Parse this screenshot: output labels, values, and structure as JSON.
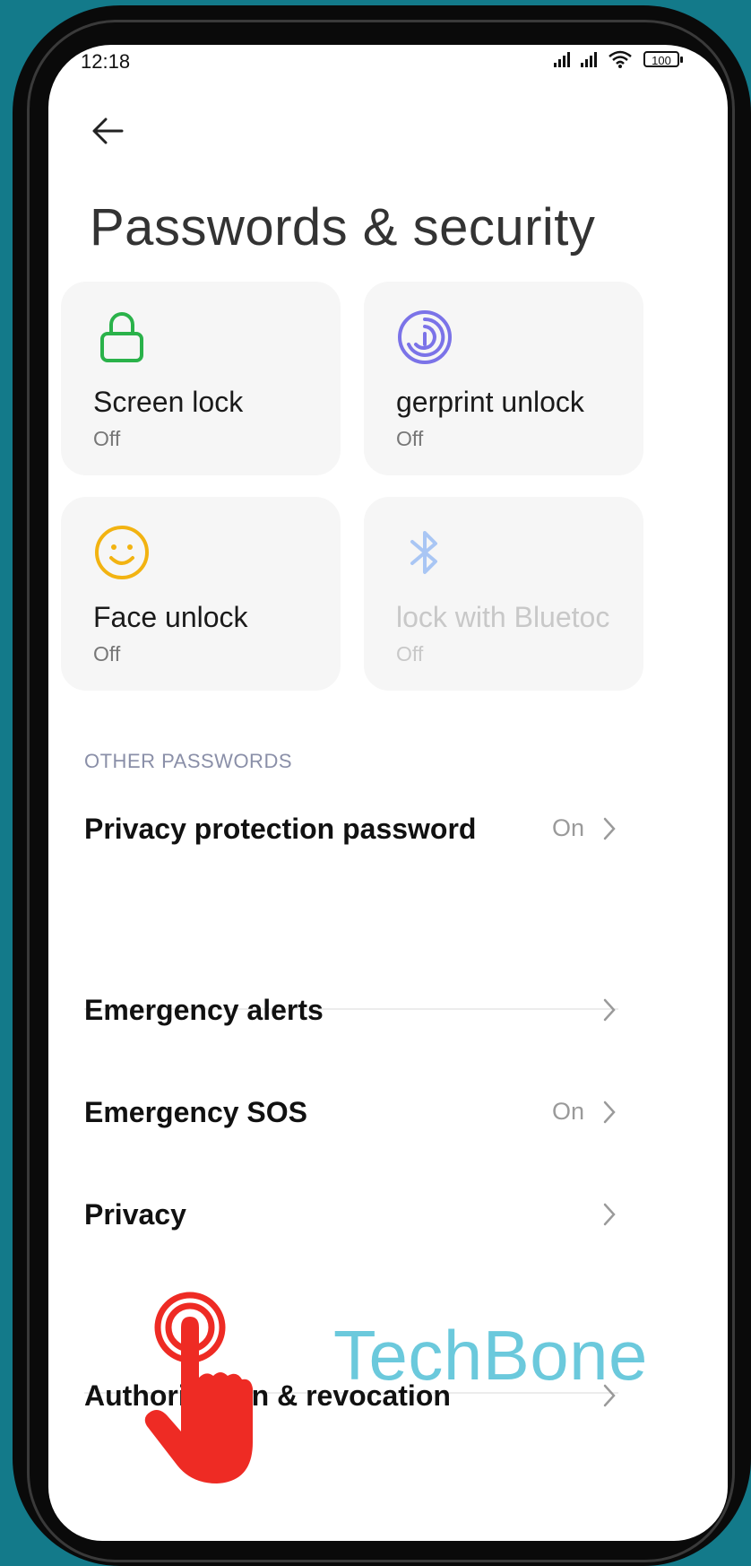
{
  "status_bar": {
    "time": "12:18",
    "battery": "100"
  },
  "page": {
    "title": "Passwords & security"
  },
  "tiles": [
    {
      "label": "Screen lock",
      "sub": "Off",
      "icon": "lock-icon",
      "color": "#2ab24a"
    },
    {
      "label": "gerprint unlock",
      "sub": "Off",
      "icon": "fingerprint-icon",
      "color": "#7b73e8"
    },
    {
      "label": "Face unlock",
      "sub": "Off",
      "icon": "face-icon",
      "color": "#f2b311"
    },
    {
      "label": "lock with Bluetoc",
      "sub": "Off",
      "icon": "bluetooth-icon",
      "color": "#a9c6f4"
    }
  ],
  "other_passwords": {
    "header": "OTHER PASSWORDS",
    "items": [
      {
        "label": "Privacy protection password",
        "value": "On"
      }
    ]
  },
  "list": [
    {
      "label": "Emergency alerts",
      "value": ""
    },
    {
      "label": "Emergency SOS",
      "value": "On"
    },
    {
      "label": "Privacy",
      "value": ""
    },
    {
      "label": "Authorization & revocation",
      "value": ""
    }
  ],
  "watermark": "TechBone",
  "colors": {
    "background": "#137a8a",
    "accent_red": "#ee2b24",
    "watermark": "#5bc4d9"
  }
}
